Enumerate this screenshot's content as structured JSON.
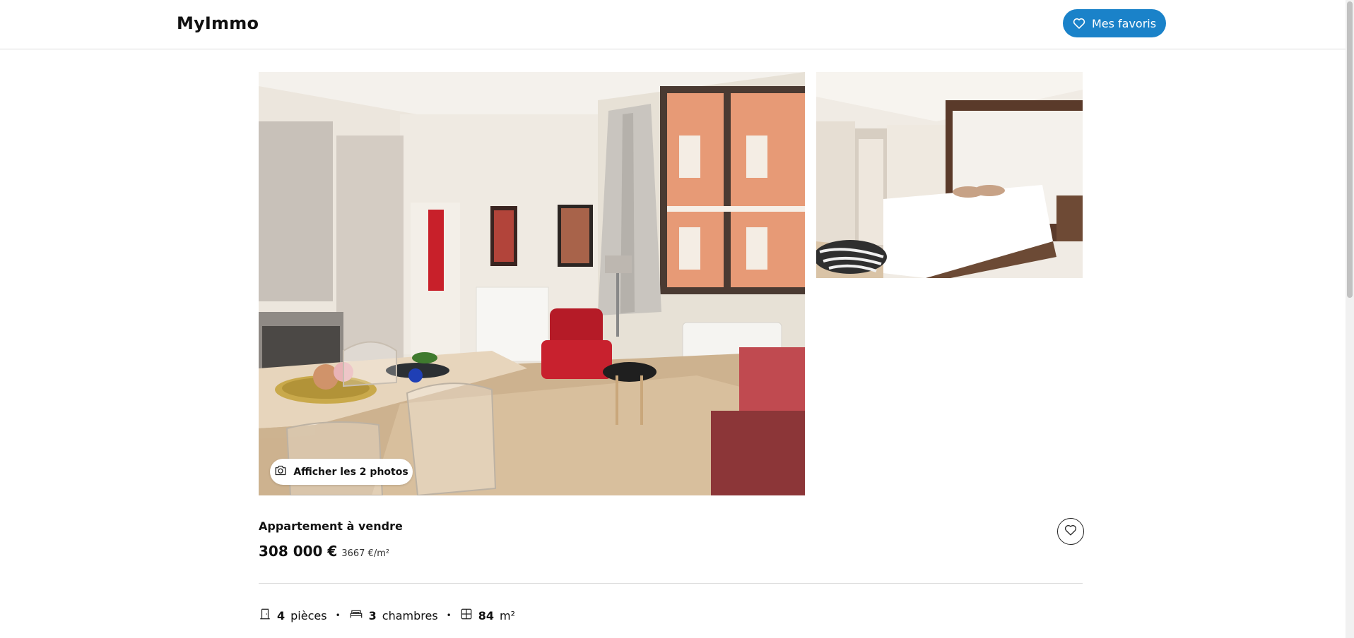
{
  "header": {
    "logo": "MyImmo",
    "favorites_label": "Mes favoris"
  },
  "gallery": {
    "show_photos_label": "Afficher les 2 photos",
    "main_photo_alt": "living room with kitchen and red armchair",
    "side_photo_alt": "bedroom with white bed"
  },
  "listing": {
    "type": "Appartement à vendre",
    "price": "308 000 €",
    "price_per_m2": "3667 €/m²"
  },
  "features": [
    {
      "icon": "door-icon",
      "value": "4",
      "label": "pièces"
    },
    {
      "icon": "bed-icon",
      "value": "3",
      "label": "chambres"
    },
    {
      "icon": "floor-plan-icon",
      "value": "84",
      "label": "m²"
    }
  ],
  "colors": {
    "accent": "#1a82c9",
    "text": "#111111",
    "divider": "#d9d9d9"
  }
}
